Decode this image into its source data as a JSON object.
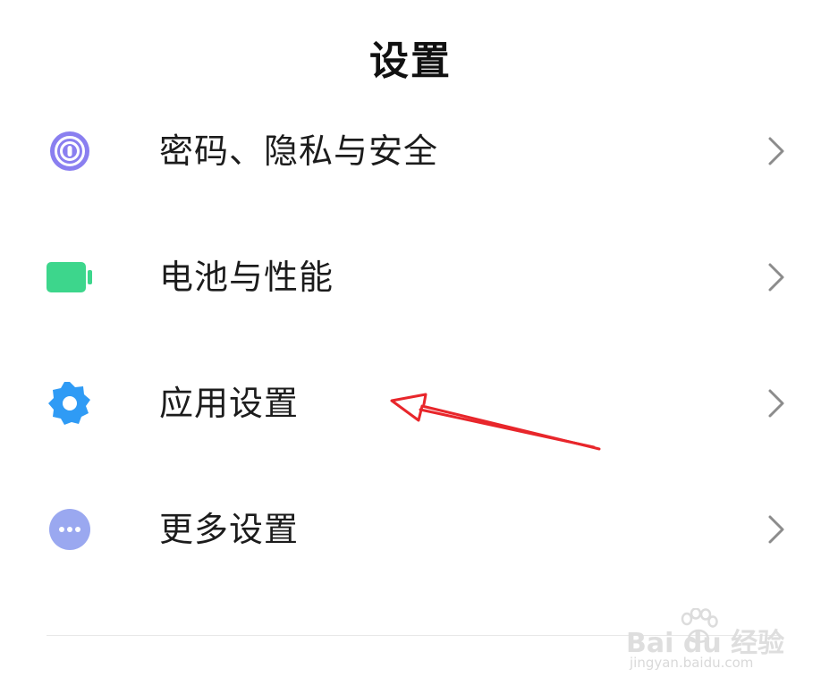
{
  "header": {
    "title": "设置"
  },
  "settings_list": {
    "items": [
      {
        "label": "密码、隐私与安全",
        "icon": "fingerprint-icon",
        "color": "#8A7FF0"
      },
      {
        "label": "电池与性能",
        "icon": "battery-icon",
        "color": "#3DD68C"
      },
      {
        "label": "应用设置",
        "icon": "gear-icon",
        "color": "#2F9BF5"
      },
      {
        "label": "更多设置",
        "icon": "more-dots-icon",
        "color": "#9AA8F0"
      }
    ],
    "chevron_icon": "chevron-right-icon"
  },
  "annotation": {
    "arrow_color": "#E8262B"
  },
  "watermark": {
    "brand": "Bai du 经验",
    "domain": "jingyan.baidu.com"
  }
}
